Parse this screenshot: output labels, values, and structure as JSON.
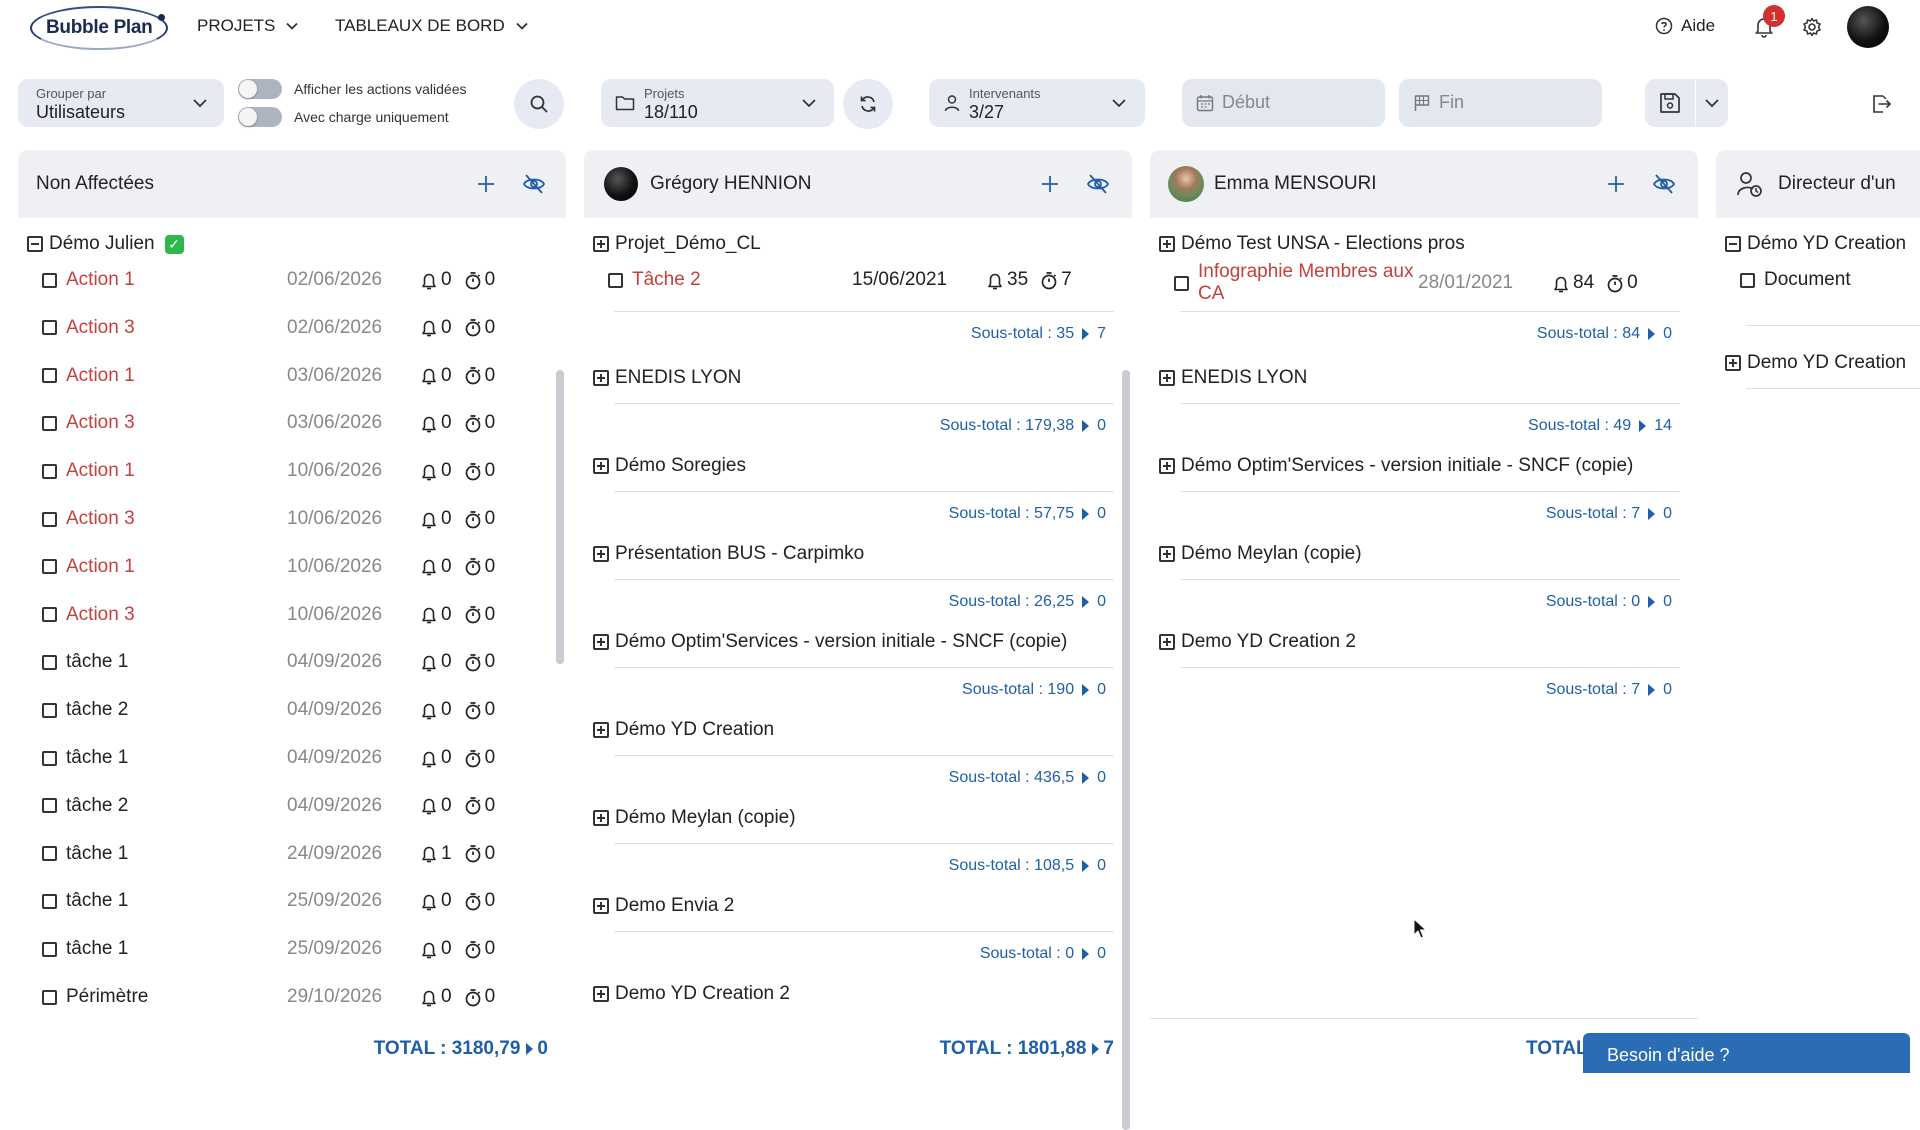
{
  "app": {
    "logo_text": "Bubble Plan"
  },
  "nav": {
    "menus": [
      {
        "label": "PROJETS"
      },
      {
        "label": "TABLEAUX DE BORD"
      }
    ],
    "help_label": "Aide",
    "notifications_count": "1"
  },
  "toolbar": {
    "group_by_label": "Grouper par",
    "group_by_value": "Utilisateurs",
    "toggle_validated": "Afficher les actions validées",
    "toggle_charge": "Avec charge uniquement",
    "projects_label": "Projets",
    "projects_value": "18/110",
    "intervenants_label": "Intervenants",
    "intervenants_value": "3/27",
    "start_placeholder": "Début",
    "end_placeholder": "Fin"
  },
  "columns": [
    {
      "title": "Non Affectées",
      "total": "TOTAL : 3180,79",
      "total_count": "0",
      "group": "Démo Julien",
      "rows": [
        {
          "name": "Action 1",
          "date": "02/06/2026",
          "charge": "0",
          "time": "0",
          "red": true
        },
        {
          "name": "Action 3",
          "date": "02/06/2026",
          "charge": "0",
          "time": "0",
          "red": true
        },
        {
          "name": "Action 1",
          "date": "03/06/2026",
          "charge": "0",
          "time": "0",
          "red": true
        },
        {
          "name": "Action 3",
          "date": "03/06/2026",
          "charge": "0",
          "time": "0",
          "red": true
        },
        {
          "name": "Action 1",
          "date": "10/06/2026",
          "charge": "0",
          "time": "0",
          "red": true
        },
        {
          "name": "Action 3",
          "date": "10/06/2026",
          "charge": "0",
          "time": "0",
          "red": true
        },
        {
          "name": "Action 1",
          "date": "10/06/2026",
          "charge": "0",
          "time": "0",
          "red": true
        },
        {
          "name": "Action 3",
          "date": "10/06/2026",
          "charge": "0",
          "time": "0",
          "red": true
        },
        {
          "name": "tâche 1",
          "date": "04/09/2026",
          "charge": "0",
          "time": "0",
          "red": false
        },
        {
          "name": "tâche 2",
          "date": "04/09/2026",
          "charge": "0",
          "time": "0",
          "red": false
        },
        {
          "name": "tâche 1",
          "date": "04/09/2026",
          "charge": "0",
          "time": "0",
          "red": false
        },
        {
          "name": "tâche 2",
          "date": "04/09/2026",
          "charge": "0",
          "time": "0",
          "red": false
        },
        {
          "name": "tâche 1",
          "date": "24/09/2026",
          "charge": "1",
          "time": "0",
          "red": false
        },
        {
          "name": "tâche 1",
          "date": "25/09/2026",
          "charge": "0",
          "time": "0",
          "red": false
        },
        {
          "name": "tâche 1",
          "date": "25/09/2026",
          "charge": "0",
          "time": "0",
          "red": false
        },
        {
          "name": "Périmètre",
          "date": "29/10/2026",
          "charge": "0",
          "time": "0",
          "red": false
        }
      ]
    },
    {
      "title": "Grégory HENNION",
      "total": "TOTAL : 1801,88",
      "total_count": "7",
      "groups": [
        {
          "name": "Projet_Démo_CL",
          "subtotal": "Sous-total : 35",
          "count": "7",
          "task": {
            "name": "Tâche 2",
            "date": "15/06/2021",
            "charge": "35",
            "time": "7"
          }
        },
        {
          "name": "ENEDIS LYON",
          "subtotal": "Sous-total : 179,38",
          "count": "0"
        },
        {
          "name": "Démo Soregies",
          "subtotal": "Sous-total : 57,75",
          "count": "0"
        },
        {
          "name": "Présentation BUS - Carpimko",
          "subtotal": "Sous-total : 26,25",
          "count": "0"
        },
        {
          "name": "Démo Optim'Services - version initiale - SNCF (copie)",
          "subtotal": "Sous-total : 190",
          "count": "0"
        },
        {
          "name": "Démo YD Creation",
          "subtotal": "Sous-total : 436,5",
          "count": "0"
        },
        {
          "name": "Démo Meylan (copie)",
          "subtotal": "Sous-total : 108,5",
          "count": "0"
        },
        {
          "name": "Demo Envia 2",
          "subtotal": "Sous-total : 0",
          "count": "0"
        },
        {
          "name": "Demo YD Creation 2",
          "subtotal": "",
          "count": ""
        }
      ]
    },
    {
      "title": "Emma MENSOURI",
      "total": "TOTAL",
      "groups": [
        {
          "name": "Démo Test UNSA - Elections pros",
          "subtotal": "Sous-total : 84",
          "count": "0",
          "task": {
            "name": "Infographie Membres aux CA",
            "date": "28/01/2021",
            "charge": "84",
            "time": "0"
          }
        },
        {
          "name": "ENEDIS LYON",
          "subtotal": "Sous-total : 49",
          "count": "14"
        },
        {
          "name": "Démo Optim'Services - version initiale - SNCF (copie)",
          "subtotal": "Sous-total : 7",
          "count": "0"
        },
        {
          "name": "Démo Meylan (copie)",
          "subtotal": "Sous-total : 0",
          "count": "0"
        },
        {
          "name": "Demo YD Creation 2",
          "subtotal": "Sous-total : 7",
          "count": "0"
        }
      ]
    },
    {
      "title": "Directeur d'un",
      "groups": [
        {
          "name": "Démo YD Creation",
          "task": {
            "name": "Document"
          }
        },
        {
          "name": "Demo YD Creation"
        }
      ]
    }
  ],
  "help_bubble": "Besoin d'aide ?",
  "colors": {
    "accent": "#1f5fa7",
    "danger": "#c4413c",
    "pill": "#e6ebf3",
    "header": "#eef0f4"
  }
}
